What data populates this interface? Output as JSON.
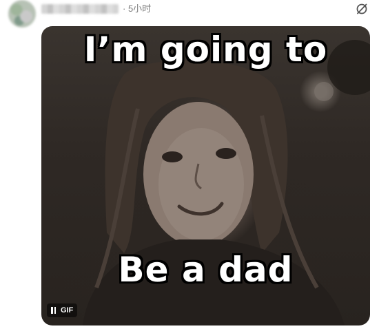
{
  "post": {
    "timestamp": "· 5小时",
    "more_icon": "refresh-slash-icon"
  },
  "media": {
    "caption_top": "I’m going to",
    "caption_bottom": "Be a dad",
    "badge_label": "GIF",
    "badge_icon": "pause-icon"
  }
}
